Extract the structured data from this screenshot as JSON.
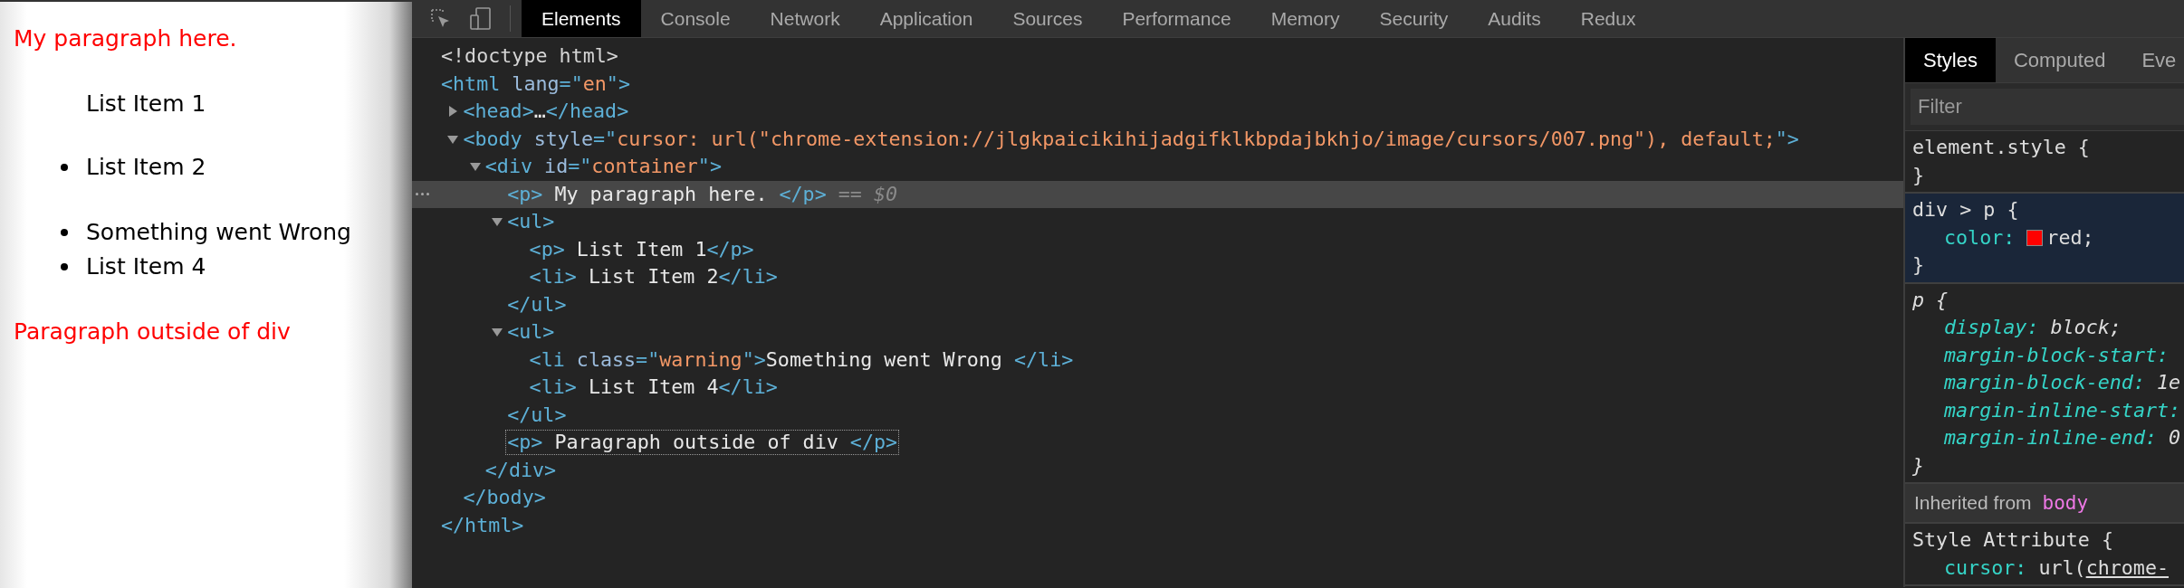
{
  "page": {
    "blocks": [
      {
        "kind": "paragraph",
        "text": "My paragraph here.",
        "color": "#ff0000"
      },
      {
        "kind": "list",
        "items": [
          {
            "kind": "paragraph",
            "text": "List Item 1",
            "color": "#000000"
          },
          {
            "kind": "bullet",
            "text": "List Item 2",
            "color": "#000000"
          }
        ]
      },
      {
        "kind": "list",
        "items": [
          {
            "kind": "bullet",
            "text": "Something went Wrong",
            "color": "#000000"
          },
          {
            "kind": "bullet",
            "text": "List Item 4",
            "color": "#000000"
          }
        ]
      },
      {
        "kind": "paragraph",
        "text": "Paragraph outside of div",
        "color": "#ff0000"
      }
    ]
  },
  "toolbar": {
    "tabs": [
      {
        "label": "Elements",
        "selected": true
      },
      {
        "label": "Console",
        "selected": false
      },
      {
        "label": "Network",
        "selected": false
      },
      {
        "label": "Application",
        "selected": false
      },
      {
        "label": "Sources",
        "selected": false
      },
      {
        "label": "Performance",
        "selected": false
      },
      {
        "label": "Memory",
        "selected": false
      },
      {
        "label": "Security",
        "selected": false
      },
      {
        "label": "Audits",
        "selected": false
      },
      {
        "label": "Redux",
        "selected": false
      }
    ]
  },
  "dom_tree": [
    {
      "selected": false,
      "hovered": false,
      "tokens": [
        {
          "kind": "doc",
          "s": "<!doctype html>"
        }
      ]
    },
    {
      "selected": false,
      "hovered": false,
      "tokens": [
        {
          "kind": "tag",
          "s": "<html"
        },
        {
          "kind": "attr",
          "s": " lang"
        },
        {
          "kind": "tag",
          "s": "=\""
        },
        {
          "kind": "value",
          "s": "en"
        },
        {
          "kind": "tag",
          "s": "\">"
        }
      ],
      "close": [
        {
          "kind": "tag",
          "s": "</html>"
        }
      ],
      "children": [
        {
          "selected": false,
          "hovered": false,
          "expanded": false,
          "tokens": [
            {
              "kind": "tag",
              "s": "<head>"
            },
            {
              "kind": "text",
              "s": "…"
            },
            {
              "kind": "tag",
              "s": "</head>"
            }
          ]
        },
        {
          "selected": false,
          "hovered": false,
          "expanded": true,
          "tokens": [
            {
              "kind": "tag",
              "s": "<body"
            },
            {
              "kind": "attr",
              "s": " style"
            },
            {
              "kind": "tag",
              "s": "=\""
            },
            {
              "kind": "value",
              "s": "cursor: url(\"chrome-extension://jlgkpaicikihijadgifklkbpdajbkhjo/image/cursors/007.png\"), default;"
            },
            {
              "kind": "tag",
              "s": "\">"
            }
          ],
          "close": [
            {
              "kind": "tag",
              "s": "</body>"
            }
          ],
          "children": [
            {
              "selected": false,
              "hovered": false,
              "expanded": true,
              "tokens": [
                {
                  "kind": "tag",
                  "s": "<div"
                },
                {
                  "kind": "attr",
                  "s": " id"
                },
                {
                  "kind": "tag",
                  "s": "=\""
                },
                {
                  "kind": "value",
                  "s": "container"
                },
                {
                  "kind": "tag",
                  "s": "\">"
                }
              ],
              "close": [
                {
                  "kind": "tag",
                  "s": "</div>"
                }
              ],
              "children": [
                {
                  "selected": true,
                  "hovered": false,
                  "tokens": [
                    {
                      "kind": "tag",
                      "s": "<p>"
                    },
                    {
                      "kind": "text",
                      "s": " My paragraph here. "
                    },
                    {
                      "kind": "tag",
                      "s": "</p>"
                    },
                    {
                      "kind": "marker",
                      "s": " == "
                    },
                    {
                      "kind": "var",
                      "s": "$0"
                    }
                  ]
                },
                {
                  "selected": false,
                  "hovered": false,
                  "expanded": true,
                  "tokens": [
                    {
                      "kind": "tag",
                      "s": "<ul>"
                    }
                  ],
                  "close": [
                    {
                      "kind": "tag",
                      "s": "</ul>"
                    }
                  ],
                  "children": [
                    {
                      "selected": false,
                      "hovered": false,
                      "tokens": [
                        {
                          "kind": "tag",
                          "s": "<p>"
                        },
                        {
                          "kind": "text",
                          "s": " List Item 1"
                        },
                        {
                          "kind": "tag",
                          "s": "</p>"
                        }
                      ]
                    },
                    {
                      "selected": false,
                      "hovered": false,
                      "tokens": [
                        {
                          "kind": "tag",
                          "s": "<li>"
                        },
                        {
                          "kind": "text",
                          "s": " List Item 2"
                        },
                        {
                          "kind": "tag",
                          "s": "</li>"
                        }
                      ]
                    }
                  ]
                },
                {
                  "selected": false,
                  "hovered": false,
                  "expanded": true,
                  "tokens": [
                    {
                      "kind": "tag",
                      "s": "<ul>"
                    }
                  ],
                  "close": [
                    {
                      "kind": "tag",
                      "s": "</ul>"
                    }
                  ],
                  "children": [
                    {
                      "selected": false,
                      "hovered": false,
                      "tokens": [
                        {
                          "kind": "tag",
                          "s": "<li"
                        },
                        {
                          "kind": "attr",
                          "s": " class"
                        },
                        {
                          "kind": "tag",
                          "s": "=\""
                        },
                        {
                          "kind": "value",
                          "s": "warning"
                        },
                        {
                          "kind": "tag",
                          "s": "\">"
                        },
                        {
                          "kind": "text",
                          "s": "Something went Wrong "
                        },
                        {
                          "kind": "tag",
                          "s": "</li>"
                        }
                      ]
                    },
                    {
                      "selected": false,
                      "hovered": false,
                      "tokens": [
                        {
                          "kind": "tag",
                          "s": "<li>"
                        },
                        {
                          "kind": "text",
                          "s": " List Item 4"
                        },
                        {
                          "kind": "tag",
                          "s": "</li>"
                        }
                      ]
                    }
                  ]
                },
                {
                  "selected": false,
                  "hovered": true,
                  "tokens": [
                    {
                      "kind": "tag",
                      "s": "<p>"
                    },
                    {
                      "kind": "text",
                      "s": " Paragraph outside of div "
                    },
                    {
                      "kind": "tag",
                      "s": "</p>"
                    }
                  ]
                }
              ]
            }
          ]
        }
      ]
    }
  ],
  "styles_panel": {
    "tabs": [
      {
        "label": "Styles",
        "selected": true
      },
      {
        "label": "Computed",
        "selected": false
      },
      {
        "label": "Eve",
        "selected": false
      }
    ],
    "filter": {
      "placeholder": "Filter"
    },
    "sections": [
      {
        "kind": "rule",
        "open": "element.style {",
        "close": "}",
        "hovered": false,
        "user_agent": false
      },
      {
        "kind": "rule",
        "open": "div > p {",
        "close": "}",
        "hovered": true,
        "user_agent": false,
        "properties": [
          {
            "name": "color:",
            "value": "red;",
            "color": "#ff0000"
          }
        ]
      },
      {
        "kind": "rule",
        "open": "p {",
        "close": "}",
        "hovered": false,
        "user_agent": true,
        "properties": [
          {
            "name": "display:",
            "value": "block;"
          },
          {
            "name": "margin-block-start:"
          },
          {
            "name": "margin-block-end:",
            "value": "1e"
          },
          {
            "name": "margin-inline-start:"
          },
          {
            "name": "margin-inline-end:",
            "value": "0"
          }
        ]
      },
      {
        "kind": "header",
        "label": "Inherited from",
        "source": "body"
      },
      {
        "kind": "rule",
        "open": "Style Attribute {",
        "hovered": false,
        "user_agent": false,
        "properties": [
          {
            "name": "cursor:",
            "value": "url(",
            "link": "chrome-"
          }
        ]
      }
    ]
  }
}
